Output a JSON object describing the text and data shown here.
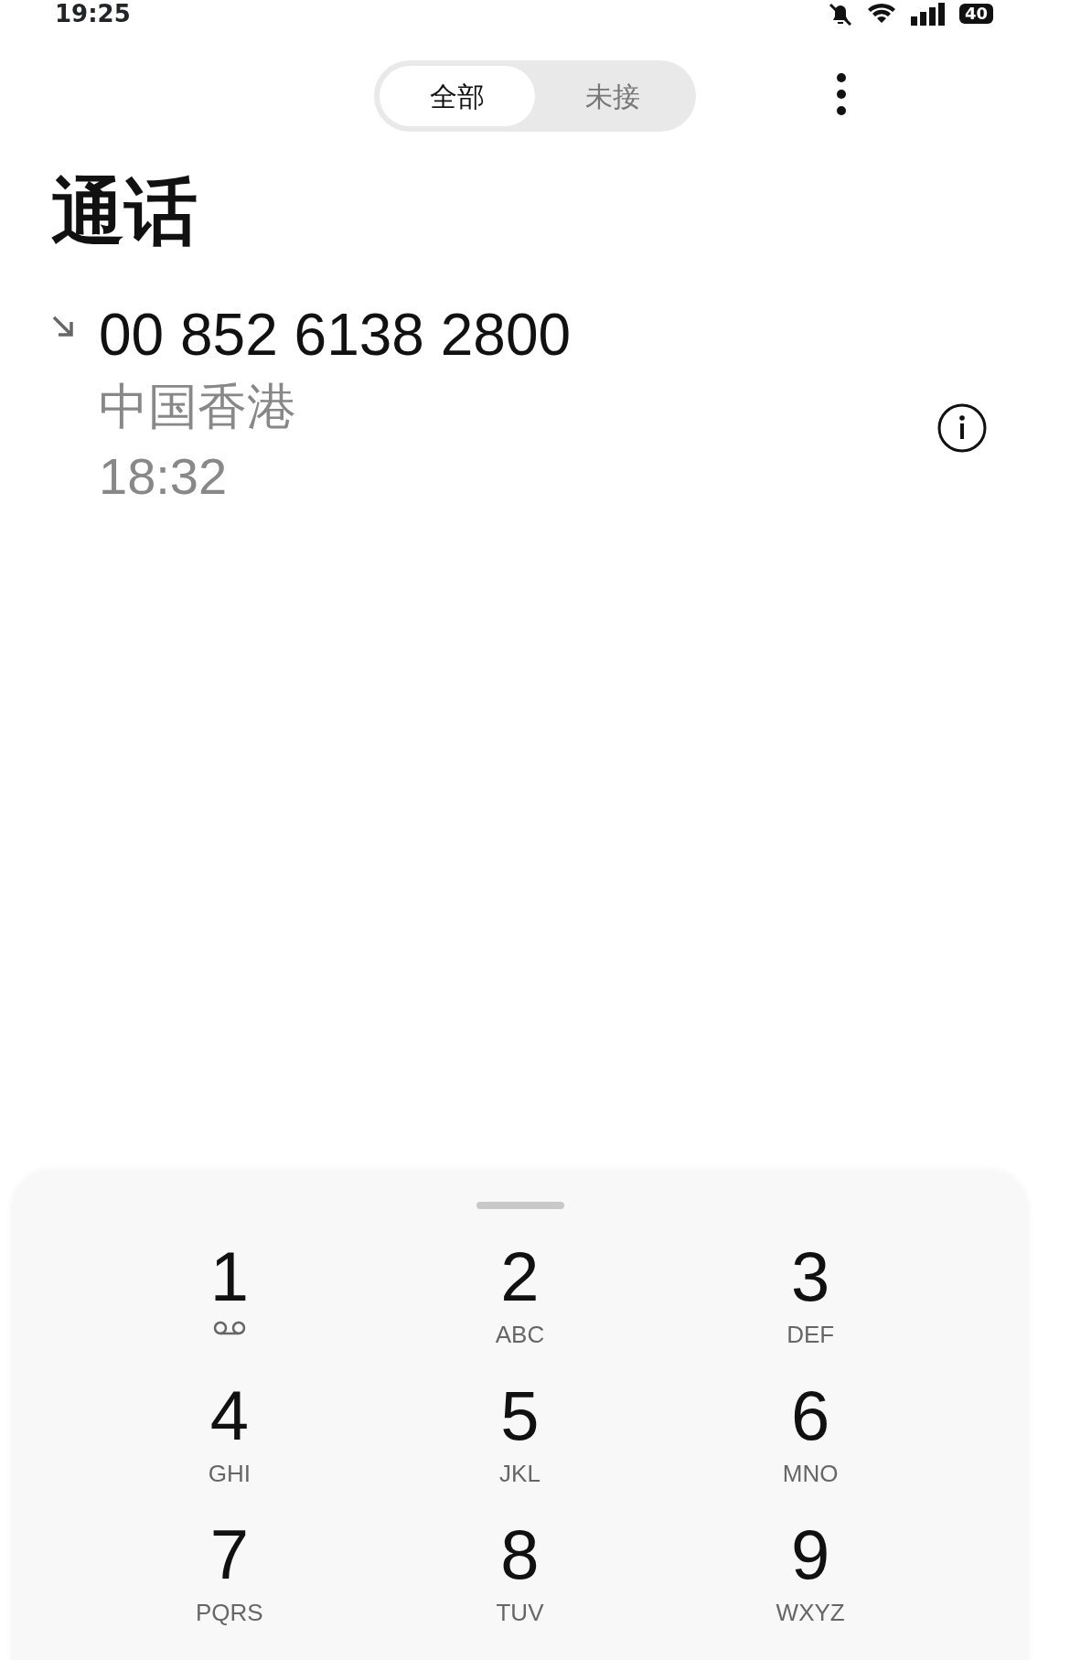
{
  "status_bar": {
    "time": "19:25",
    "battery": "40"
  },
  "tabs": [
    {
      "label": "全部",
      "selected": true
    },
    {
      "label": "未接",
      "selected": false
    }
  ],
  "title": "通话",
  "calls": [
    {
      "kind": "incoming",
      "number": "00 852 6138 2800",
      "location": "中国香港",
      "time": "18:32"
    }
  ],
  "dialpad": {
    "keys": [
      {
        "kind": "voicemail",
        "digit": "1"
      },
      {
        "kind": "letters",
        "digit": "2",
        "letters": "ABC"
      },
      {
        "kind": "letters",
        "digit": "3",
        "letters": "DEF"
      },
      {
        "kind": "letters",
        "digit": "4",
        "letters": "GHI"
      },
      {
        "kind": "letters",
        "digit": "5",
        "letters": "JKL"
      },
      {
        "kind": "letters",
        "digit": "6",
        "letters": "MNO"
      },
      {
        "kind": "letters",
        "digit": "7",
        "letters": "PQRS"
      },
      {
        "kind": "letters",
        "digit": "8",
        "letters": "TUV"
      },
      {
        "kind": "letters",
        "digit": "9",
        "letters": "WXYZ"
      }
    ]
  }
}
